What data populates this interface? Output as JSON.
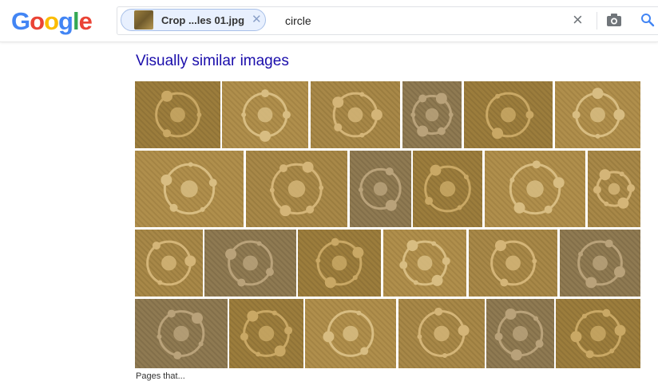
{
  "logo": {
    "letters": [
      "G",
      "o",
      "o",
      "g",
      "l",
      "e"
    ],
    "colors": [
      "#4285F4",
      "#EA4335",
      "#FBBC05",
      "#4285F4",
      "#34A853",
      "#EA4335"
    ]
  },
  "search": {
    "chip_label": "Crop ...les 01.jpg",
    "query": "circle"
  },
  "section": {
    "title": "Visually similar images"
  },
  "images": [
    {
      "row": 0,
      "tiles": [
        {
          "icon": "crop-circle-molecule-image"
        },
        {
          "icon": "crop-circle-lines-image"
        },
        {
          "icon": "crop-circle-triangle-image"
        },
        {
          "icon": "crop-circle-tail-image"
        },
        {
          "icon": "crop-circle-yin-yang-image"
        },
        {
          "icon": "crop-circle-crescent-image"
        }
      ]
    },
    {
      "row": 1,
      "tiles": [
        {
          "icon": "crop-circle-flower-image"
        },
        {
          "icon": "crop-circle-trail-image"
        },
        {
          "icon": "crop-circle-pyramid-image"
        },
        {
          "icon": "crop-circle-mandala-image"
        },
        {
          "icon": "crop-circle-ring-image"
        },
        {
          "icon": "crop-circle-partial-image"
        }
      ]
    },
    {
      "row": 2,
      "tiles": [
        {
          "icon": "circle-pendant-image"
        },
        {
          "icon": "crop-circle-spiral-image"
        },
        {
          "icon": "interlocking-rings-image"
        },
        {
          "icon": "crop-circle-eye-image"
        },
        {
          "icon": "crop-circle-dots-image"
        },
        {
          "icon": "ornate-ironwork-image"
        }
      ]
    },
    {
      "row": 3,
      "tiles": [
        {
          "icon": "crop-circle-grid-image"
        },
        {
          "icon": "circle-lamp-image"
        },
        {
          "icon": "crop-circle-double-ring-image"
        },
        {
          "icon": "crop-circle-bar-image"
        },
        {
          "icon": "table-lamp-image"
        },
        {
          "icon": "crop-circle-triskelion-image"
        }
      ]
    }
  ],
  "footer": {
    "text": "Pages that..."
  }
}
